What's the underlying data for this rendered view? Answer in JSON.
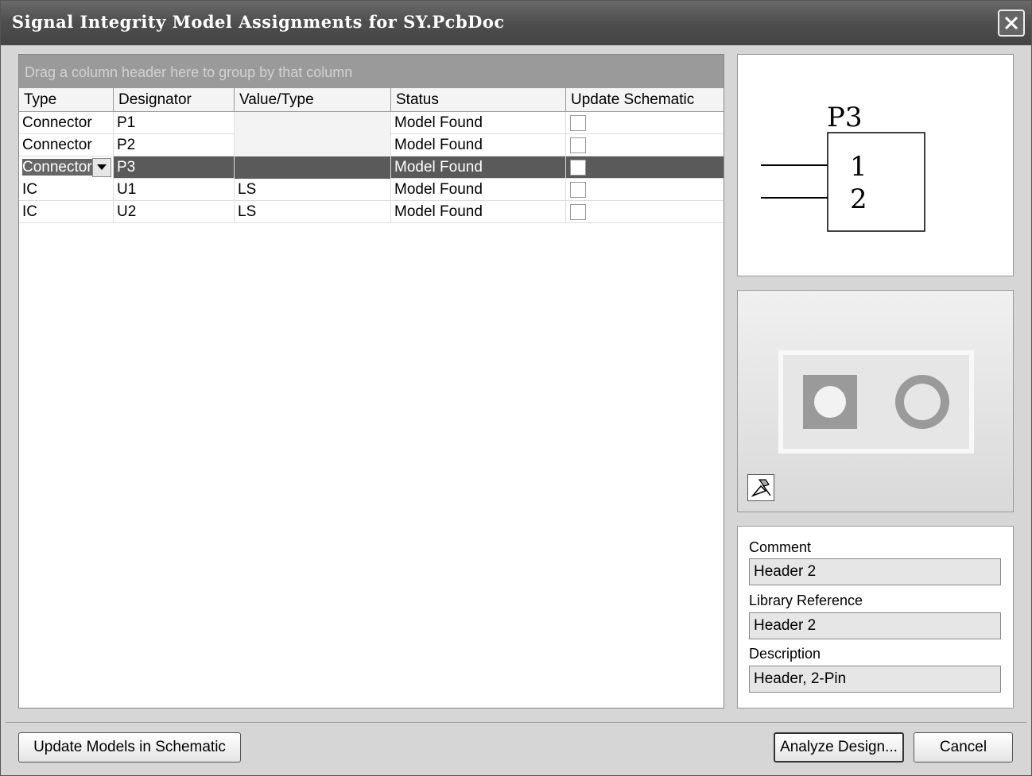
{
  "window": {
    "title": "Signal Integrity Model Assignments for SY.PcbDoc"
  },
  "grid": {
    "group_hint": "Drag a column header here to group by that column",
    "headers": [
      "Type",
      "Designator",
      "Value/Type",
      "Status",
      "Update Schematic"
    ],
    "rows": [
      {
        "type": "Connector",
        "designator": "P1",
        "value": "",
        "status": "Model Found",
        "update": false,
        "selected": false
      },
      {
        "type": "Connector",
        "designator": "P2",
        "value": "",
        "status": "Model Found",
        "update": false,
        "selected": false
      },
      {
        "type": "Connector",
        "designator": "P3",
        "value": "",
        "status": "Model Found",
        "update": false,
        "selected": true
      },
      {
        "type": "IC",
        "designator": "U1",
        "value": "LS",
        "status": "Model Found",
        "update": false,
        "selected": false
      },
      {
        "type": "IC",
        "designator": "U2",
        "value": "LS",
        "status": "Model Found",
        "update": false,
        "selected": false
      }
    ]
  },
  "schematic_preview": {
    "designator": "P3",
    "pin1": "1",
    "pin2": "2"
  },
  "pcb_preview": {
    "tool_icon": "component-tool-icon"
  },
  "details": {
    "comment_label": "Comment",
    "comment_value": "Header 2",
    "libref_label": "Library Reference",
    "libref_value": "Header 2",
    "description_label": "Description",
    "description_value": "Header, 2-Pin"
  },
  "buttons": {
    "update_models": "Update Models in Schematic",
    "analyze": "Analyze Design...",
    "cancel": "Cancel"
  },
  "colors": {
    "title_bar": "#4e4e4e",
    "selection": "#5a5a5a",
    "group_bar": "#9a9a9a"
  }
}
